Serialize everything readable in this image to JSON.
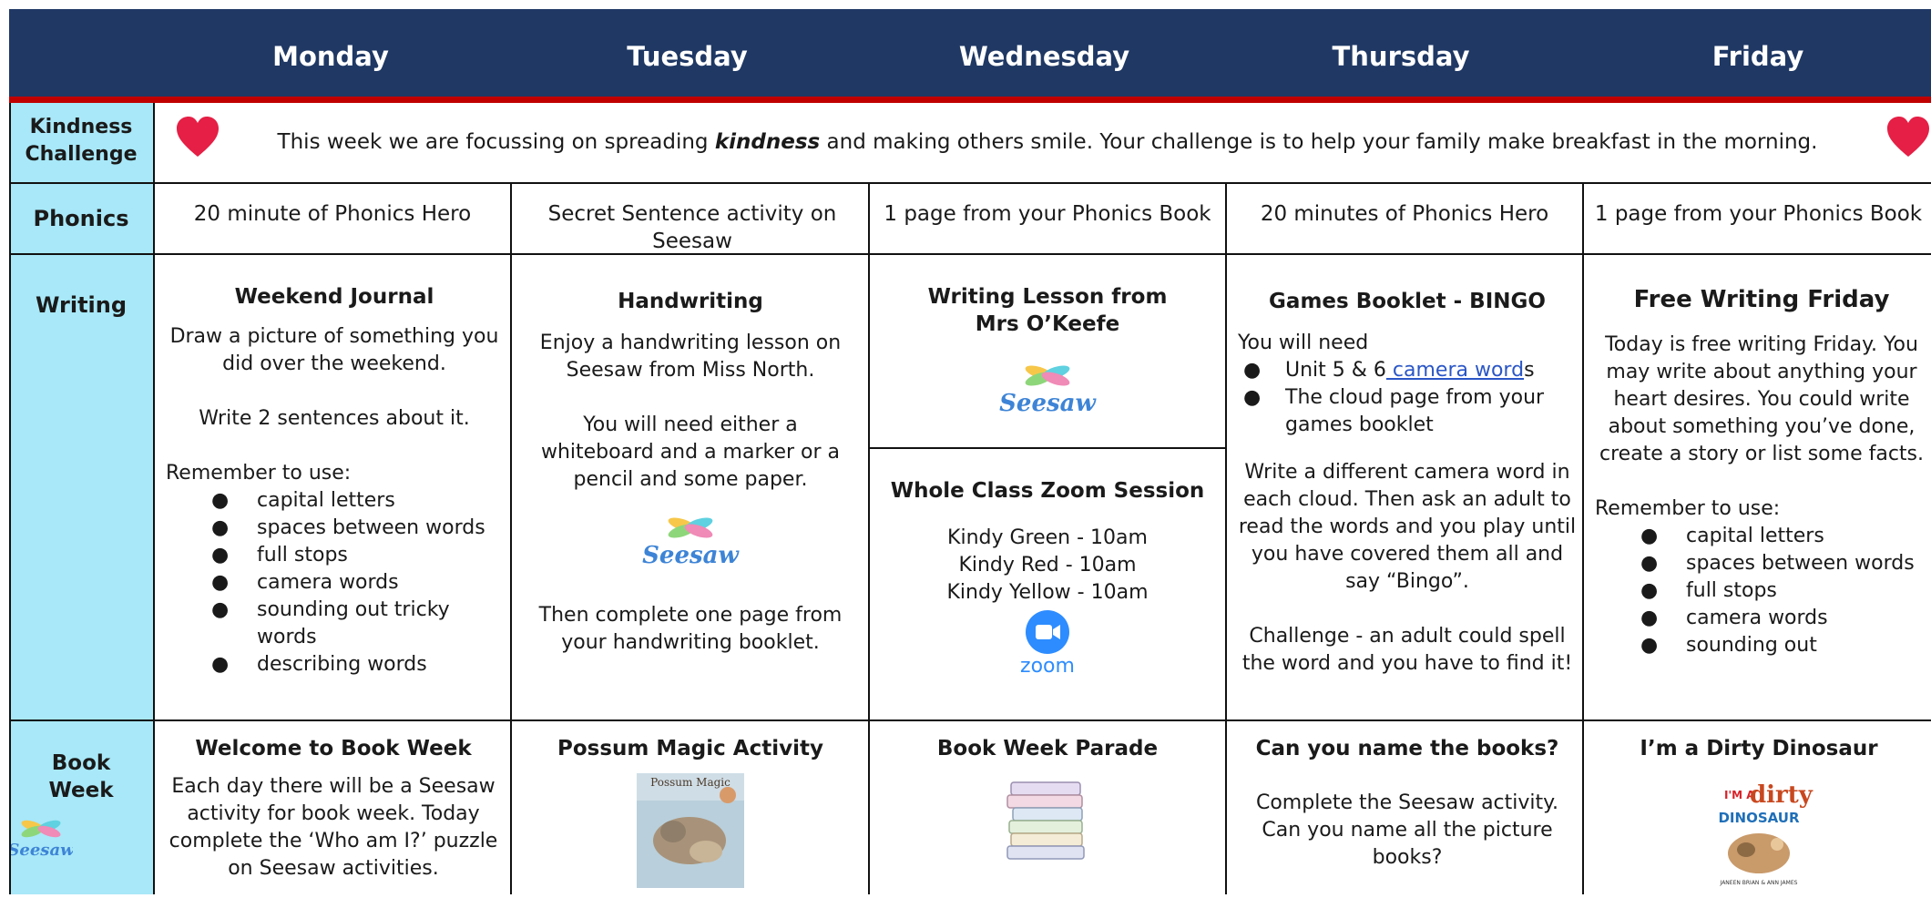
{
  "header": {
    "days": [
      "Monday",
      "Tuesday",
      "Wednesday",
      "Thursday",
      "Friday"
    ]
  },
  "rows": {
    "kindness_label_1": "Kindness",
    "kindness_label_2": "Challenge",
    "phonics_label": "Phonics",
    "writing_label": "Writing",
    "book_label_1": "Book",
    "book_label_2": "Week"
  },
  "kindness": {
    "text_before": "This week we are focussing on spreading ",
    "emphasis": "kindness",
    "text_after": " and making others smile.  Your challenge is to help your family make breakfast in the morning."
  },
  "phonics": [
    "20 minute of Phonics Hero",
    "Secret Sentence activity on Seesaw",
    "1 page from your Phonics Book",
    "20 minutes of Phonics Hero",
    "1 page from your Phonics Book"
  ],
  "writing": {
    "monday": {
      "title": "Weekend Journal",
      "p1": "Draw a picture of something you did over the weekend.",
      "p2": "Write 2 sentences about it.",
      "remember": "Remember to use:",
      "bullets": [
        "capital letters",
        "spaces between words",
        "full stops",
        "camera words",
        "sounding out tricky words",
        "describing words"
      ]
    },
    "tuesday": {
      "title": "Handwriting",
      "p1": "Enjoy a handwriting lesson on Seesaw from Miss North.",
      "p2": "You will need either a whiteboard and a marker or a pencil and some paper.",
      "logo": "Seesaw",
      "p3": "Then complete one page from your handwriting booklet."
    },
    "wednesday": {
      "title_1": "Writing Lesson from",
      "title_2": "Mrs O’Keefe",
      "logo": "Seesaw",
      "zoom_title": "Whole Class Zoom Session",
      "sessions": [
        "Kindy Green - 10am",
        "Kindy Red - 10am",
        "Kindy Yellow - 10am"
      ],
      "zoom_logo": "zoom"
    },
    "thursday": {
      "title": "Games Booklet - BINGO",
      "need": "You will need",
      "b1_pre": "Unit 5 & 6",
      "b1_link": " camera word",
      "b1_post": "s",
      "b2": "The cloud page from your games booklet",
      "p1": "Write a different camera word in each cloud. Then ask an adult to read the words and you play until you have covered them all and say “Bingo”.",
      "p2": "Challenge - an adult could spell the word and you have to find it!"
    },
    "friday": {
      "title": "Free Writing Friday",
      "p1": "Today is free writing Friday. You may write about anything your heart desires. You could write about something you’ve done, create a story or list some facts.",
      "remember": "Remember to use:",
      "bullets": [
        "capital letters",
        "spaces between words",
        "full stops",
        "camera words",
        "sounding out"
      ]
    }
  },
  "book_week": {
    "logo": "Seesaw",
    "monday": {
      "title": "Welcome to Book Week",
      "p1": "Each day there will be a Seesaw activity for book week. Today complete the ‘Who am I?’ puzzle on Seesaw activities."
    },
    "tuesday": {
      "title": "Possum Magic Activity",
      "book_title": "Possum Magic"
    },
    "wednesday": {
      "title": "Book Week Parade"
    },
    "thursday": {
      "title": "Can you name the books?",
      "p1": "Complete the Seesaw activity. Can you name all the picture books?"
    },
    "friday": {
      "title": "I’m a Dirty Dinosaur",
      "cover_1": "I'M A",
      "cover_2": "dirty",
      "cover_3": "DINOSAUR",
      "authors": "JANEEN BRIAN & ANN JAMES"
    }
  },
  "colors": {
    "header": "#1f3864",
    "accent_line": "#c00000",
    "label_bg": "#a8e8f8",
    "link": "#2a56c6"
  }
}
